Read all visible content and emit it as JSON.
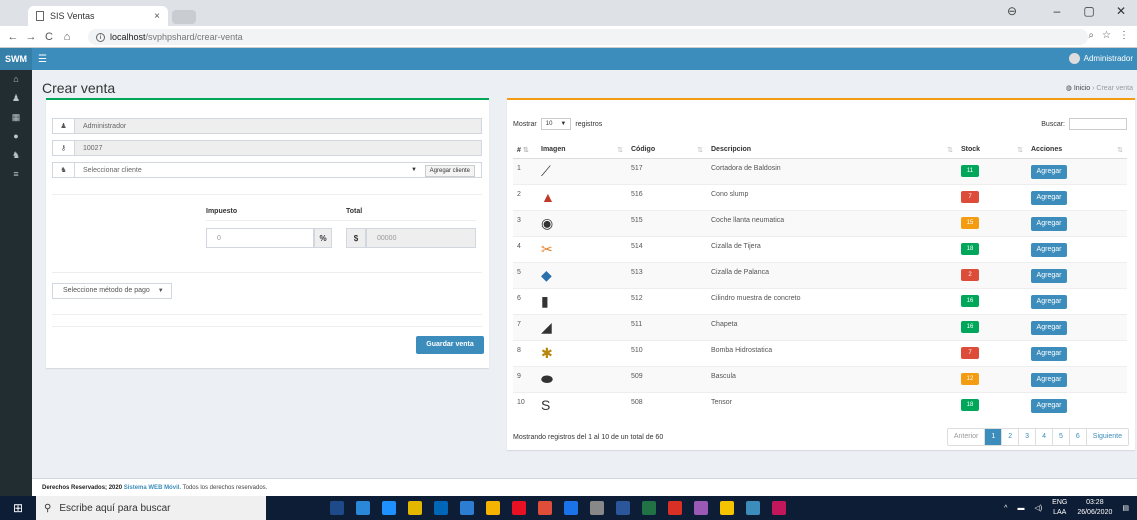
{
  "browser": {
    "tab_title": "SIS Ventas",
    "url_host": "localhost",
    "url_path": "/svphpshard/crear-venta"
  },
  "header": {
    "logo": "SWM",
    "user": "Administrador"
  },
  "page": {
    "title": "Crear venta",
    "crumb_home": "Inicio",
    "crumb_current": "Crear venta"
  },
  "sale_form": {
    "seller": "Administrador",
    "code": "10027",
    "client_placeholder": "Seleccionar cliente",
    "add_client": "Agregar cliente",
    "tax_label": "Impuesto",
    "total_label": "Total",
    "tax_value": "0",
    "percent": "%",
    "dollar": "$",
    "total_value": "00000",
    "payment_placeholder": "Seleccione método de pago",
    "save": "Guardar venta"
  },
  "table": {
    "show": "Mostrar",
    "page_size": "10",
    "records": "registros",
    "search_label": "Buscar:",
    "headers": [
      "#",
      "Imagen",
      "Código",
      "Descripcion",
      "Stock",
      "Acciones"
    ],
    "rows": [
      {
        "n": "1",
        "code": "517",
        "desc": "Cortadora de Baldosin",
        "stock": "11",
        "color": "#00a65a",
        "icon": "tile-cutter-icon"
      },
      {
        "n": "2",
        "code": "516",
        "desc": "Cono slump",
        "stock": "7",
        "color": "#dd4b39",
        "icon": "slump-cone-icon"
      },
      {
        "n": "3",
        "code": "515",
        "desc": "Coche llanta neumatica",
        "stock": "15",
        "color": "#f39c12",
        "icon": "wheel-icon"
      },
      {
        "n": "4",
        "code": "514",
        "desc": "Cizalla de Tijera",
        "stock": "18",
        "color": "#00a65a",
        "icon": "shears-icon"
      },
      {
        "n": "5",
        "code": "513",
        "desc": "Cizalla de Palanca",
        "stock": "2",
        "color": "#dd4b39",
        "icon": "lever-shear-icon"
      },
      {
        "n": "6",
        "code": "512",
        "desc": "Cilindro muestra de concreto",
        "stock": "16",
        "color": "#00a65a",
        "icon": "cylinder-icon"
      },
      {
        "n": "7",
        "code": "511",
        "desc": "Chapeta",
        "stock": "16",
        "color": "#00a65a",
        "icon": "chapeta-icon"
      },
      {
        "n": "8",
        "code": "510",
        "desc": "Bomba Hidrostatica",
        "stock": "7",
        "color": "#dd4b39",
        "icon": "pump-icon"
      },
      {
        "n": "9",
        "code": "509",
        "desc": "Bascula",
        "stock": "12",
        "color": "#f39c12",
        "icon": "scale-icon"
      },
      {
        "n": "10",
        "code": "508",
        "desc": "Tensor",
        "stock": "18",
        "color": "#00a65a",
        "icon": "tensor-icon"
      }
    ],
    "action": "Agregar",
    "info": "Mostrando registros del 1 al 10 de un total de 60",
    "pager": [
      "Anterior",
      "1",
      "2",
      "3",
      "4",
      "5",
      "6",
      "Siguiente"
    ]
  },
  "footer": {
    "prefix": "Derechos Reservados; 2020 ",
    "brand": "Sistema WEB Móvil.",
    "suffix": " Todos los derechos reservados."
  },
  "taskbar": {
    "search": "Escribe aquí para buscar",
    "lang1": "ENG",
    "lang2": "LAA",
    "time": "03:28",
    "date": "26/06/2020"
  }
}
